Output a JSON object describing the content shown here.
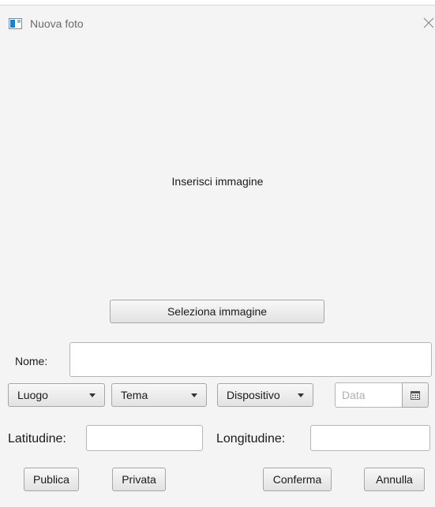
{
  "window": {
    "title": "Nuova foto",
    "app_icon": "window-app-icon",
    "close_icon": "close-icon"
  },
  "image_area": {
    "placeholder": "Inserisci immagine",
    "select_button": "Seleziona immagine"
  },
  "form": {
    "name_label": "Nome:",
    "name_value": "",
    "place_combo": "Luogo",
    "theme_combo": "Tema",
    "device_combo": "Dispositivo",
    "date_placeholder": "Data",
    "date_icon": "calendar-icon",
    "latitude_label": "Latitudine:",
    "latitude_value": "",
    "longitude_label": "Longitudine:",
    "longitude_value": ""
  },
  "actions": {
    "publish": "Publica",
    "private": "Privata",
    "confirm": "Conferma",
    "cancel": "Annulla"
  }
}
